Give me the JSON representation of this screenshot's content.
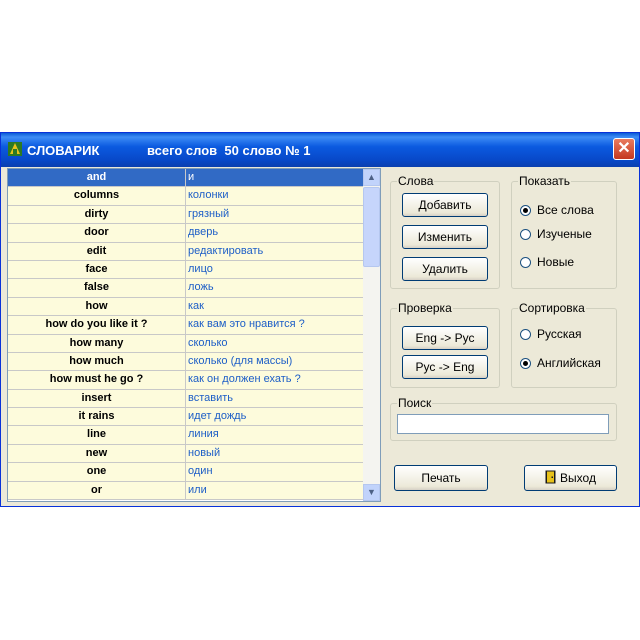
{
  "window": {
    "title": "СЛОВАРИК",
    "subtitle": "всего слов  50 слово № 1",
    "close_glyph": "✕"
  },
  "words": [
    {
      "en": "and",
      "ru": "и"
    },
    {
      "en": "columns",
      "ru": "колонки"
    },
    {
      "en": "dirty",
      "ru": "грязный"
    },
    {
      "en": "door",
      "ru": "дверь"
    },
    {
      "en": "edit",
      "ru": "редактировать"
    },
    {
      "en": "face",
      "ru": "лицо"
    },
    {
      "en": "false",
      "ru": "ложь"
    },
    {
      "en": "how",
      "ru": "как"
    },
    {
      "en": "how do you like it ?",
      "ru": "как вам это нравится ?"
    },
    {
      "en": "how many",
      "ru": "сколько"
    },
    {
      "en": "how much",
      "ru": "сколько (для массы)"
    },
    {
      "en": "how must he go ?",
      "ru": "как он должен ехать ?"
    },
    {
      "en": "insert",
      "ru": "вставить"
    },
    {
      "en": "it rains",
      "ru": "идет дождь"
    },
    {
      "en": "line",
      "ru": "линия"
    },
    {
      "en": "new",
      "ru": "новый"
    },
    {
      "en": "one",
      "ru": "один"
    },
    {
      "en": "or",
      "ru": "или"
    }
  ],
  "words_group": {
    "legend": "Слова",
    "add": "Добавить",
    "edit": "Изменить",
    "delete": "Удалить"
  },
  "show_group": {
    "legend": "Показать",
    "all": "Все слова",
    "learned": "Изученые",
    "new": "Новые",
    "selected": "all"
  },
  "check_group": {
    "legend": "Проверка",
    "eng_rus": "Eng -> Рус",
    "rus_eng": "Рус -> Eng"
  },
  "sort_group": {
    "legend": "Сортировка",
    "russian": "Русская",
    "english": "Английская",
    "selected": "english"
  },
  "search": {
    "legend": "Поиск",
    "value": ""
  },
  "print_label": "Печать",
  "exit_label": "Выход",
  "colors": {
    "selection": "#316ac5",
    "row_bg": "#fdfbdc",
    "ru_text": "#1d5ec7",
    "title_bar": "#0b5ae0",
    "face": "#ece9d8"
  }
}
